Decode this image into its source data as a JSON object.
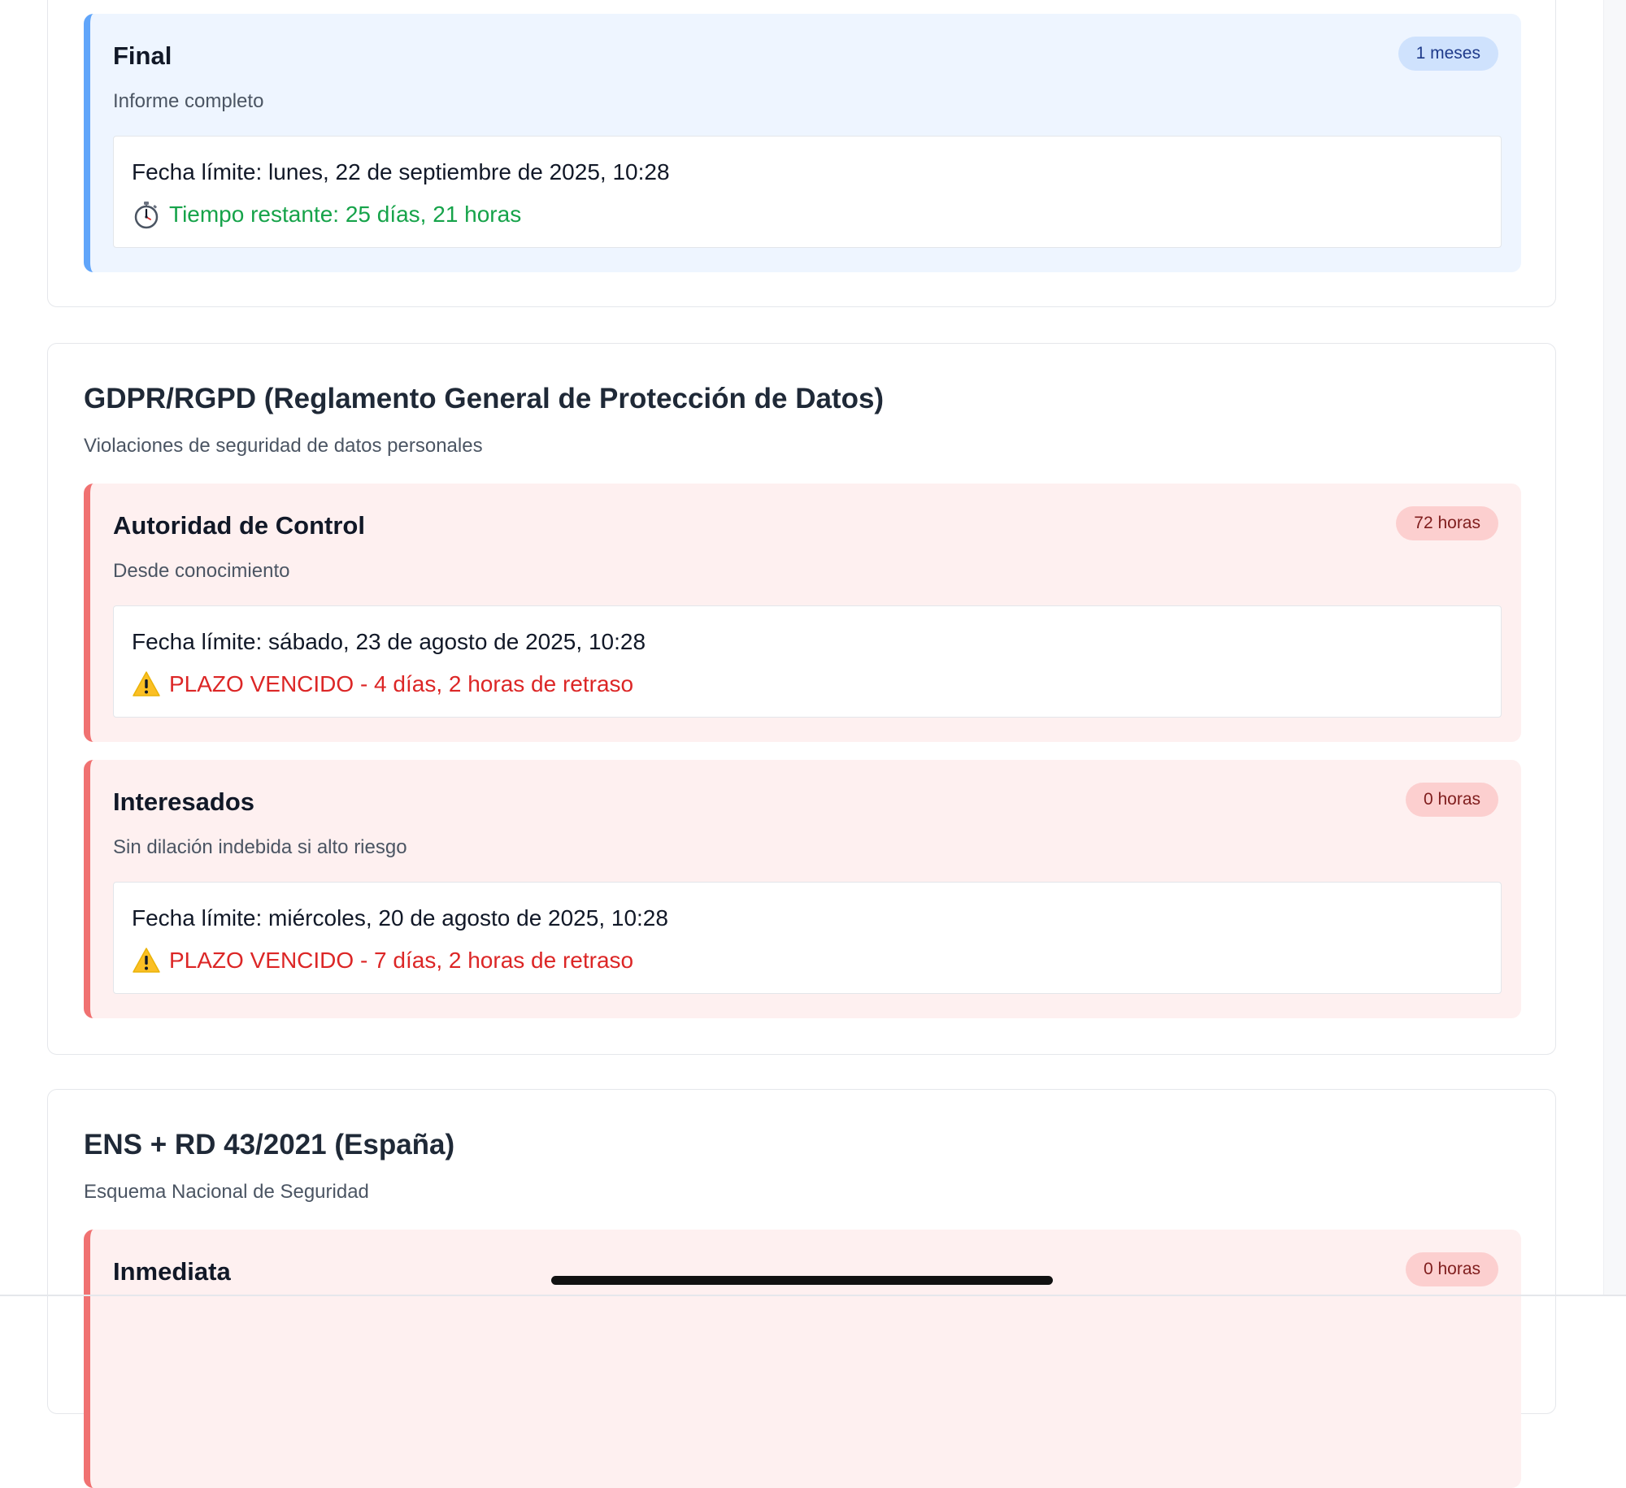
{
  "sections": [
    {
      "deadlines": [
        {
          "title": "Final",
          "badge": "1 meses",
          "description": "Informe completo",
          "date_label": "Fecha límite: lunes, 22 de septiembre de 2025, 10:28",
          "status": "Tiempo restante: 25 días, 21 horas",
          "status_icon": "stopwatch-icon",
          "color": "#60a5fa"
        }
      ]
    },
    {
      "title": "GDPR/RGPD (Reglamento General de Protección de Datos)",
      "subtitle": "Violaciones de seguridad de datos personales",
      "deadlines": [
        {
          "title": "Autoridad de Control",
          "badge": "72 horas",
          "description": "Desde conocimiento",
          "date_label": "Fecha límite: sábado, 23 de agosto de 2025, 10:28",
          "status": "PLAZO VENCIDO - 4 días, 2 horas de retraso",
          "status_icon": "warning-icon",
          "color": "#f07171"
        },
        {
          "title": "Interesados",
          "badge": "0 horas",
          "description": "Sin dilación indebida si alto riesgo",
          "date_label": "Fecha límite: miércoles, 20 de agosto de 2025, 10:28",
          "status": "PLAZO VENCIDO - 7 días, 2 horas de retraso",
          "status_icon": "warning-icon",
          "color": "#f07171"
        }
      ]
    },
    {
      "title": "ENS + RD 43/2021 (España)",
      "subtitle": "Esquema Nacional de Seguridad",
      "deadlines": [
        {
          "title": "Inmediata",
          "badge": "0 horas",
          "color": "#f07171"
        }
      ]
    }
  ],
  "colors": {
    "ok_text": "#16a34a",
    "late_text": "#dc2626",
    "blue_card_bg": "#eef5ff",
    "red_card_bg": "#fef0f0"
  }
}
